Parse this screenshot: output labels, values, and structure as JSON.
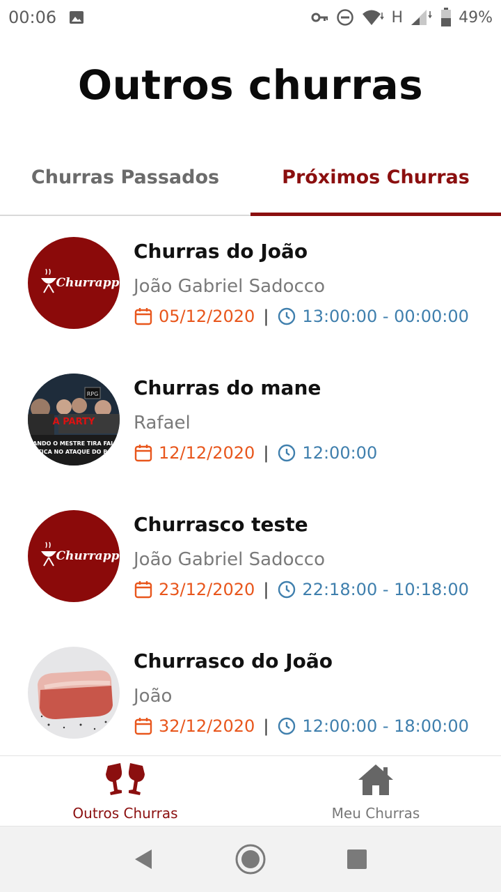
{
  "status_bar": {
    "time": "00:06",
    "network": "H",
    "battery": "49%"
  },
  "title": "Outros churras",
  "tabs": [
    {
      "label": "Churras Passados",
      "active": false
    },
    {
      "label": "Próximos Churras",
      "active": true
    }
  ],
  "events": [
    {
      "title": "Churras do João",
      "host": "João Gabriel Sadocco",
      "date": "05/12/2020",
      "time": "13:00:00 - 00:00:00",
      "avatar": "churrapp-logo"
    },
    {
      "title": "Churras do mane",
      "host": "Rafael",
      "date": "12/12/2020",
      "time": "12:00:00",
      "avatar": "meme-photo",
      "avatar_text": {
        "badge": "RPG",
        "banner": "A PARTY",
        "caption_line1": "OBANDO O MESTRE TIRA FALHO",
        "caption_line2": "RÍTICA NO ATAQUE DO BOS"
      }
    },
    {
      "title": "Churrasco teste",
      "host": "João Gabriel Sadocco",
      "date": "23/12/2020",
      "time": "22:18:00 - 10:18:00",
      "avatar": "churrapp-logo"
    },
    {
      "title": "Churrasco do João",
      "host": "João",
      "date": "32/12/2020",
      "time": "12:00:00 - 18:00:00",
      "avatar": "meat-photo"
    }
  ],
  "logo_text": "Churrapp",
  "bottom_nav": [
    {
      "label": "Outros Churras",
      "icon": "wine-glasses-icon",
      "active": true
    },
    {
      "label": "Meu Churras",
      "icon": "home-icon",
      "active": false
    }
  ],
  "colors": {
    "brand": "#8b0f0f",
    "date": "#e8561c",
    "time": "#3f7fad",
    "muted": "#7a7a7a"
  }
}
